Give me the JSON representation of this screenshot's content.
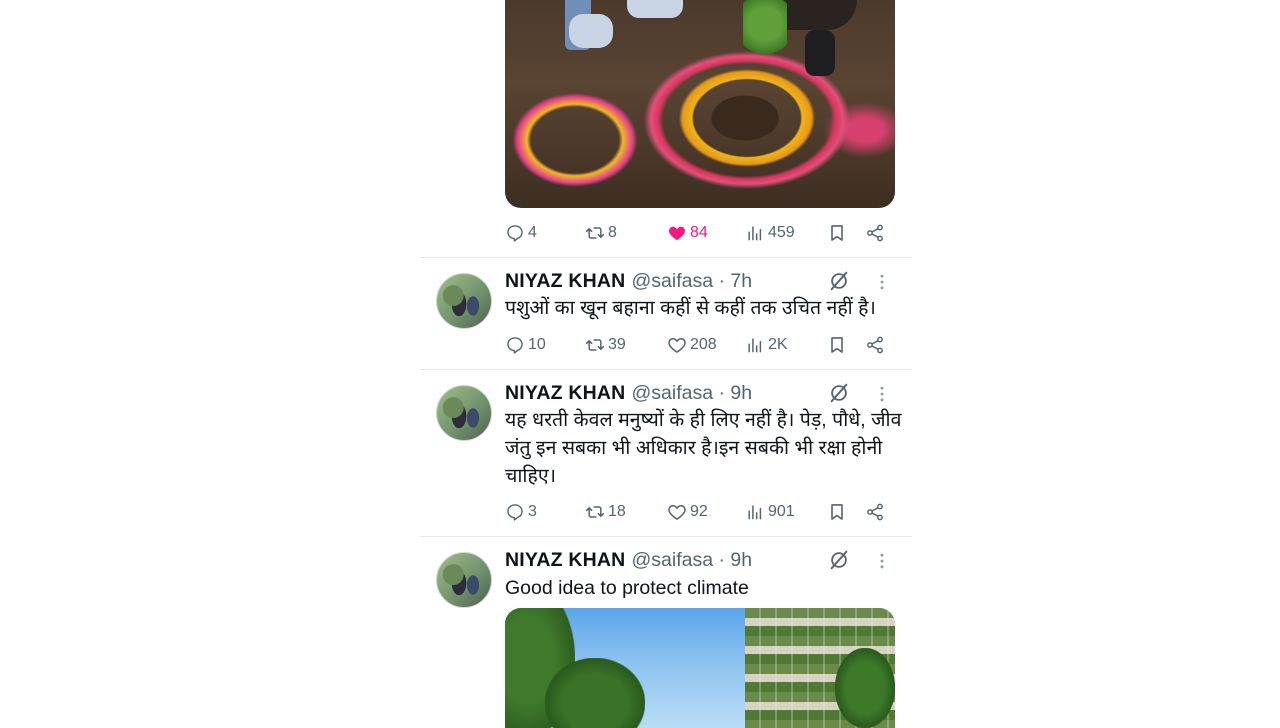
{
  "post0": {
    "stats": {
      "replies": "4",
      "reposts": "8",
      "likes": "84",
      "views": "459"
    },
    "liked": true
  },
  "posts": [
    {
      "author": "NIYAZ KHAN",
      "handle": "@saifasa",
      "time": "7h",
      "text": "पशुओं का खून बहाना कहीं से कहीं तक उचित नहीं है।",
      "stats": {
        "replies": "10",
        "reposts": "39",
        "likes": "208",
        "views": "2K"
      }
    },
    {
      "author": "NIYAZ KHAN",
      "handle": "@saifasa",
      "time": "9h",
      "text": "यह धरती केवल मनुष्यों के ही लिए नहीं है। पेड़, पौधे, जीव जंतु इन सबका भी अधिकार है।इन सबकी भी रक्षा होनी चाहिए।",
      "stats": {
        "replies": "3",
        "reposts": "18",
        "likes": "92",
        "views": "901"
      }
    },
    {
      "author": "NIYAZ KHAN",
      "handle": "@saifasa",
      "time": "9h",
      "text": "Good idea to protect climate"
    }
  ],
  "icons": {
    "reply": "reply-icon",
    "repost": "repost-icon",
    "like": "heart-icon",
    "views": "views-icon",
    "bookmark": "bookmark-icon",
    "share": "share-icon",
    "grok": "grok-icon",
    "more": "more-vertical-icon"
  },
  "colors": {
    "like_active": "#f91880",
    "muted": "#536471",
    "text": "#0f1419",
    "divider": "#e7e9ea"
  }
}
